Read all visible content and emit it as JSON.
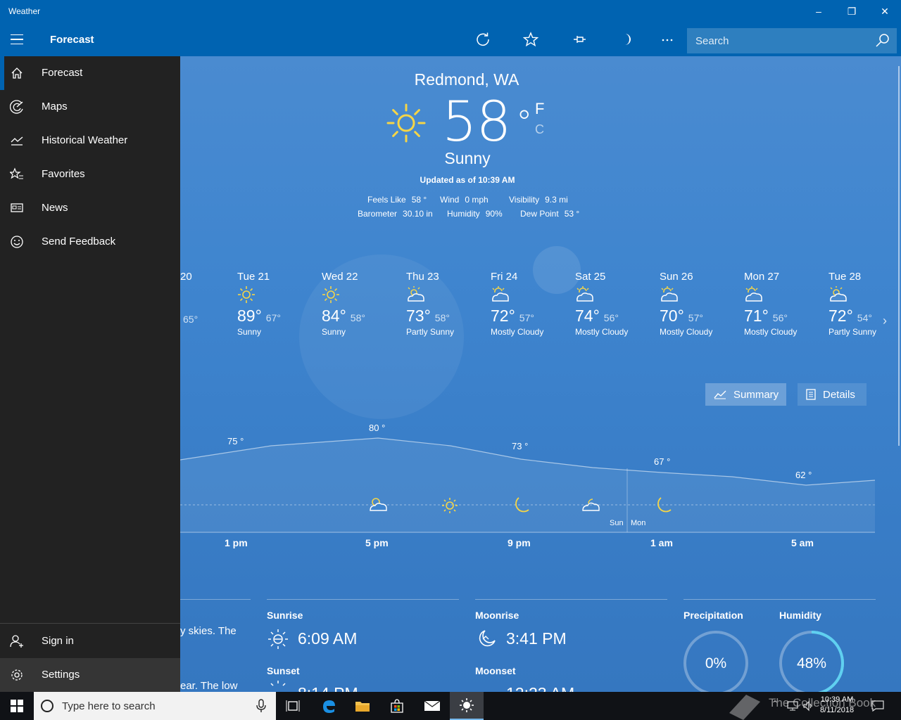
{
  "window": {
    "title": "Weather",
    "minimize": "–",
    "maximize": "❐",
    "close": "✕"
  },
  "appbar": {
    "section_title": "Forecast",
    "search_placeholder": "Search"
  },
  "nav": {
    "items": [
      {
        "label": "Forecast",
        "icon": "home-icon"
      },
      {
        "label": "Maps",
        "icon": "radar-icon"
      },
      {
        "label": "Historical Weather",
        "icon": "chart-icon"
      },
      {
        "label": "Favorites",
        "icon": "star-list-icon"
      },
      {
        "label": "News",
        "icon": "news-icon"
      },
      {
        "label": "Send Feedback",
        "icon": "smiley-icon"
      }
    ],
    "bottom": [
      {
        "label": "Sign in",
        "icon": "person-add-icon"
      },
      {
        "label": "Settings",
        "icon": "gear-icon"
      }
    ]
  },
  "current": {
    "location": "Redmond, WA",
    "temperature": "58",
    "degree": "°",
    "unit_f": "F",
    "unit_c": "C",
    "condition": "Sunny",
    "updated": "Updated as of 10:39 AM",
    "details": [
      {
        "label": "Feels Like",
        "value": "58 °"
      },
      {
        "label": "Wind",
        "value": "0 mph"
      },
      {
        "label": "Visibility",
        "value": "9.3 mi"
      },
      {
        "label": "Barometer",
        "value": "30.10 in"
      },
      {
        "label": "Humidity",
        "value": "90%"
      },
      {
        "label": "Dew Point",
        "value": "53 °"
      }
    ]
  },
  "daily": {
    "partial": {
      "day": "20",
      "lo": "65°"
    },
    "days": [
      {
        "day": "Tue 21",
        "hi": "89°",
        "lo": "67°",
        "cond": "Sunny",
        "icon": "sun-icon"
      },
      {
        "day": "Wed 22",
        "hi": "84°",
        "lo": "58°",
        "cond": "Sunny",
        "icon": "sun-icon"
      },
      {
        "day": "Thu 23",
        "hi": "73°",
        "lo": "58°",
        "cond": "Partly Sunny",
        "icon": "partly-sunny-icon"
      },
      {
        "day": "Fri 24",
        "hi": "72°",
        "lo": "57°",
        "cond": "Mostly Cloudy",
        "icon": "mostly-cloudy-icon"
      },
      {
        "day": "Sat 25",
        "hi": "74°",
        "lo": "56°",
        "cond": "Mostly Cloudy",
        "icon": "mostly-cloudy-icon"
      },
      {
        "day": "Sun 26",
        "hi": "70°",
        "lo": "57°",
        "cond": "Mostly Cloudy",
        "icon": "mostly-cloudy-icon"
      },
      {
        "day": "Mon 27",
        "hi": "71°",
        "lo": "56°",
        "cond": "Mostly Cloudy",
        "icon": "mostly-cloudy-icon"
      },
      {
        "day": "Tue 28",
        "hi": "72°",
        "lo": "54°",
        "cond": "Partly Sunny",
        "icon": "partly-sunny-icon"
      }
    ]
  },
  "tabs": {
    "summary": "Summary",
    "details": "Details"
  },
  "hourly": {
    "temp_labels": [
      "75 °",
      "80 °",
      "73 °",
      "67 °",
      "62 °"
    ],
    "time_labels": [
      "1 pm",
      "5 pm",
      "9 pm",
      "1 am",
      "5 am"
    ],
    "day_divider": {
      "before": "Sun",
      "after": "Mon"
    },
    "icons": [
      "partly-sunny-icon",
      "sun-icon",
      "moon-icon",
      "partly-cloudy-night-icon",
      "moon-icon"
    ]
  },
  "panels": {
    "summary_text_1": "y skies. The",
    "summary_text_2": "ear. The low",
    "sunrise_label": "Sunrise",
    "sunrise": "6:09 AM",
    "sunset_label": "Sunset",
    "sunset": "8:14 PM",
    "moonrise_label": "Moonrise",
    "moonrise": "3:41 PM",
    "moonset_label": "Moonset",
    "moonset": "12:23 AM",
    "precip_label": "Precipitation",
    "precip": "0%",
    "precip_fraction": 0,
    "humidity_label": "Humidity",
    "humidity": "48%",
    "humidity_fraction": 0.48
  },
  "taskbar": {
    "search_placeholder": "Type here to search",
    "time": "10:39 AM",
    "date": "8/11/2018",
    "watermark": "The Collection Book"
  },
  "colors": {
    "accent": "#0063b1",
    "nav_bg": "#222222",
    "sun": "#f5d547",
    "ring": "#5fd0f0"
  }
}
